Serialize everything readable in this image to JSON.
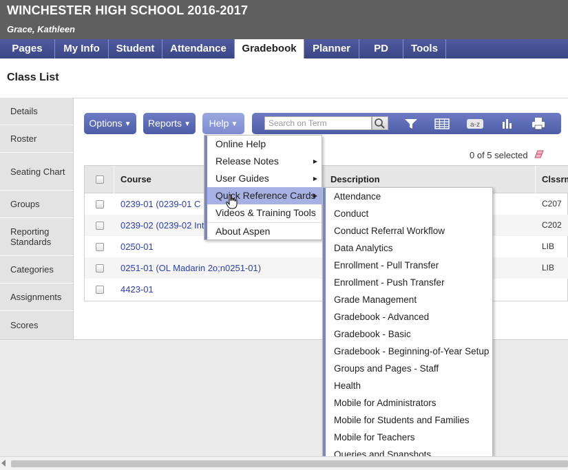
{
  "header": {
    "school_title": "WINCHESTER HIGH SCHOOL 2016-2017",
    "user_name": "Grace, Kathleen"
  },
  "topnav": {
    "tabs": [
      {
        "label": "Pages"
      },
      {
        "label": "My Info"
      },
      {
        "label": "Student"
      },
      {
        "label": "Attendance"
      },
      {
        "label": "Gradebook",
        "active": true
      },
      {
        "label": "Planner"
      },
      {
        "label": "PD"
      },
      {
        "label": "Tools"
      }
    ]
  },
  "page": {
    "title": "Class List"
  },
  "sidebar": {
    "items": [
      {
        "label": "Details"
      },
      {
        "label": "Roster"
      },
      {
        "label": "Seating Chart"
      },
      {
        "label": "Groups"
      },
      {
        "label": "Reporting Standards"
      },
      {
        "label": "Categories"
      },
      {
        "label": "Assignments"
      },
      {
        "label": "Scores"
      }
    ]
  },
  "toolbar": {
    "options_label": "Options",
    "reports_label": "Reports",
    "help_label": "Help",
    "search_placeholder": "Search on Term",
    "icons": [
      "search-icon",
      "filter-icon",
      "grid-view-icon",
      "sort-az-icon",
      "chart-icon",
      "print-icon"
    ]
  },
  "selection": {
    "text": "0 of 5 selected"
  },
  "table": {
    "headers": {
      "course": "Course",
      "description": "Description",
      "room": "Clssrm"
    },
    "rows": [
      {
        "course": "0239-01 (0239-01 C E",
        "room": "C207"
      },
      {
        "course": "0239-02 (0239-02 Intr",
        "room": "C202"
      },
      {
        "course": "0250-01",
        "room": "LIB"
      },
      {
        "course": "0251-01 (OL Madarin 2o;n0251-01)",
        "room": "LIB"
      },
      {
        "course": "4423-01",
        "room": ""
      }
    ]
  },
  "help_menu": {
    "items": [
      {
        "label": "Online Help",
        "submenu": false
      },
      {
        "label": "Release Notes",
        "submenu": true
      },
      {
        "label": "User Guides",
        "submenu": true
      },
      {
        "label": "Quick Reference Cards",
        "submenu": true,
        "highlighted": true
      },
      {
        "label": "Videos & Training Tools",
        "submenu": false
      },
      {
        "label": "About Aspen",
        "submenu": false
      }
    ]
  },
  "quick_reference_cards": {
    "items": [
      "Attendance",
      "Conduct",
      "Conduct Referral Workflow",
      "Data Analytics",
      "Enrollment - Pull Transfer",
      "Enrollment - Push Transfer",
      "Grade Management",
      "Gradebook - Advanced",
      "Gradebook - Basic",
      "Gradebook - Beginning-of-Year Setup",
      "Groups and Pages - Staff",
      "Health",
      "Mobile for Administrators",
      "Mobile for Students and Families",
      "Mobile for Teachers",
      "Queries and Snapshots"
    ]
  },
  "colors": {
    "header_bg": "#5f5f5f",
    "nav_blue": "#4a56a0",
    "button_blue": "#5c6ab5",
    "link_blue": "#2a3fb4",
    "menu_highlight": "#a7b1e3"
  }
}
